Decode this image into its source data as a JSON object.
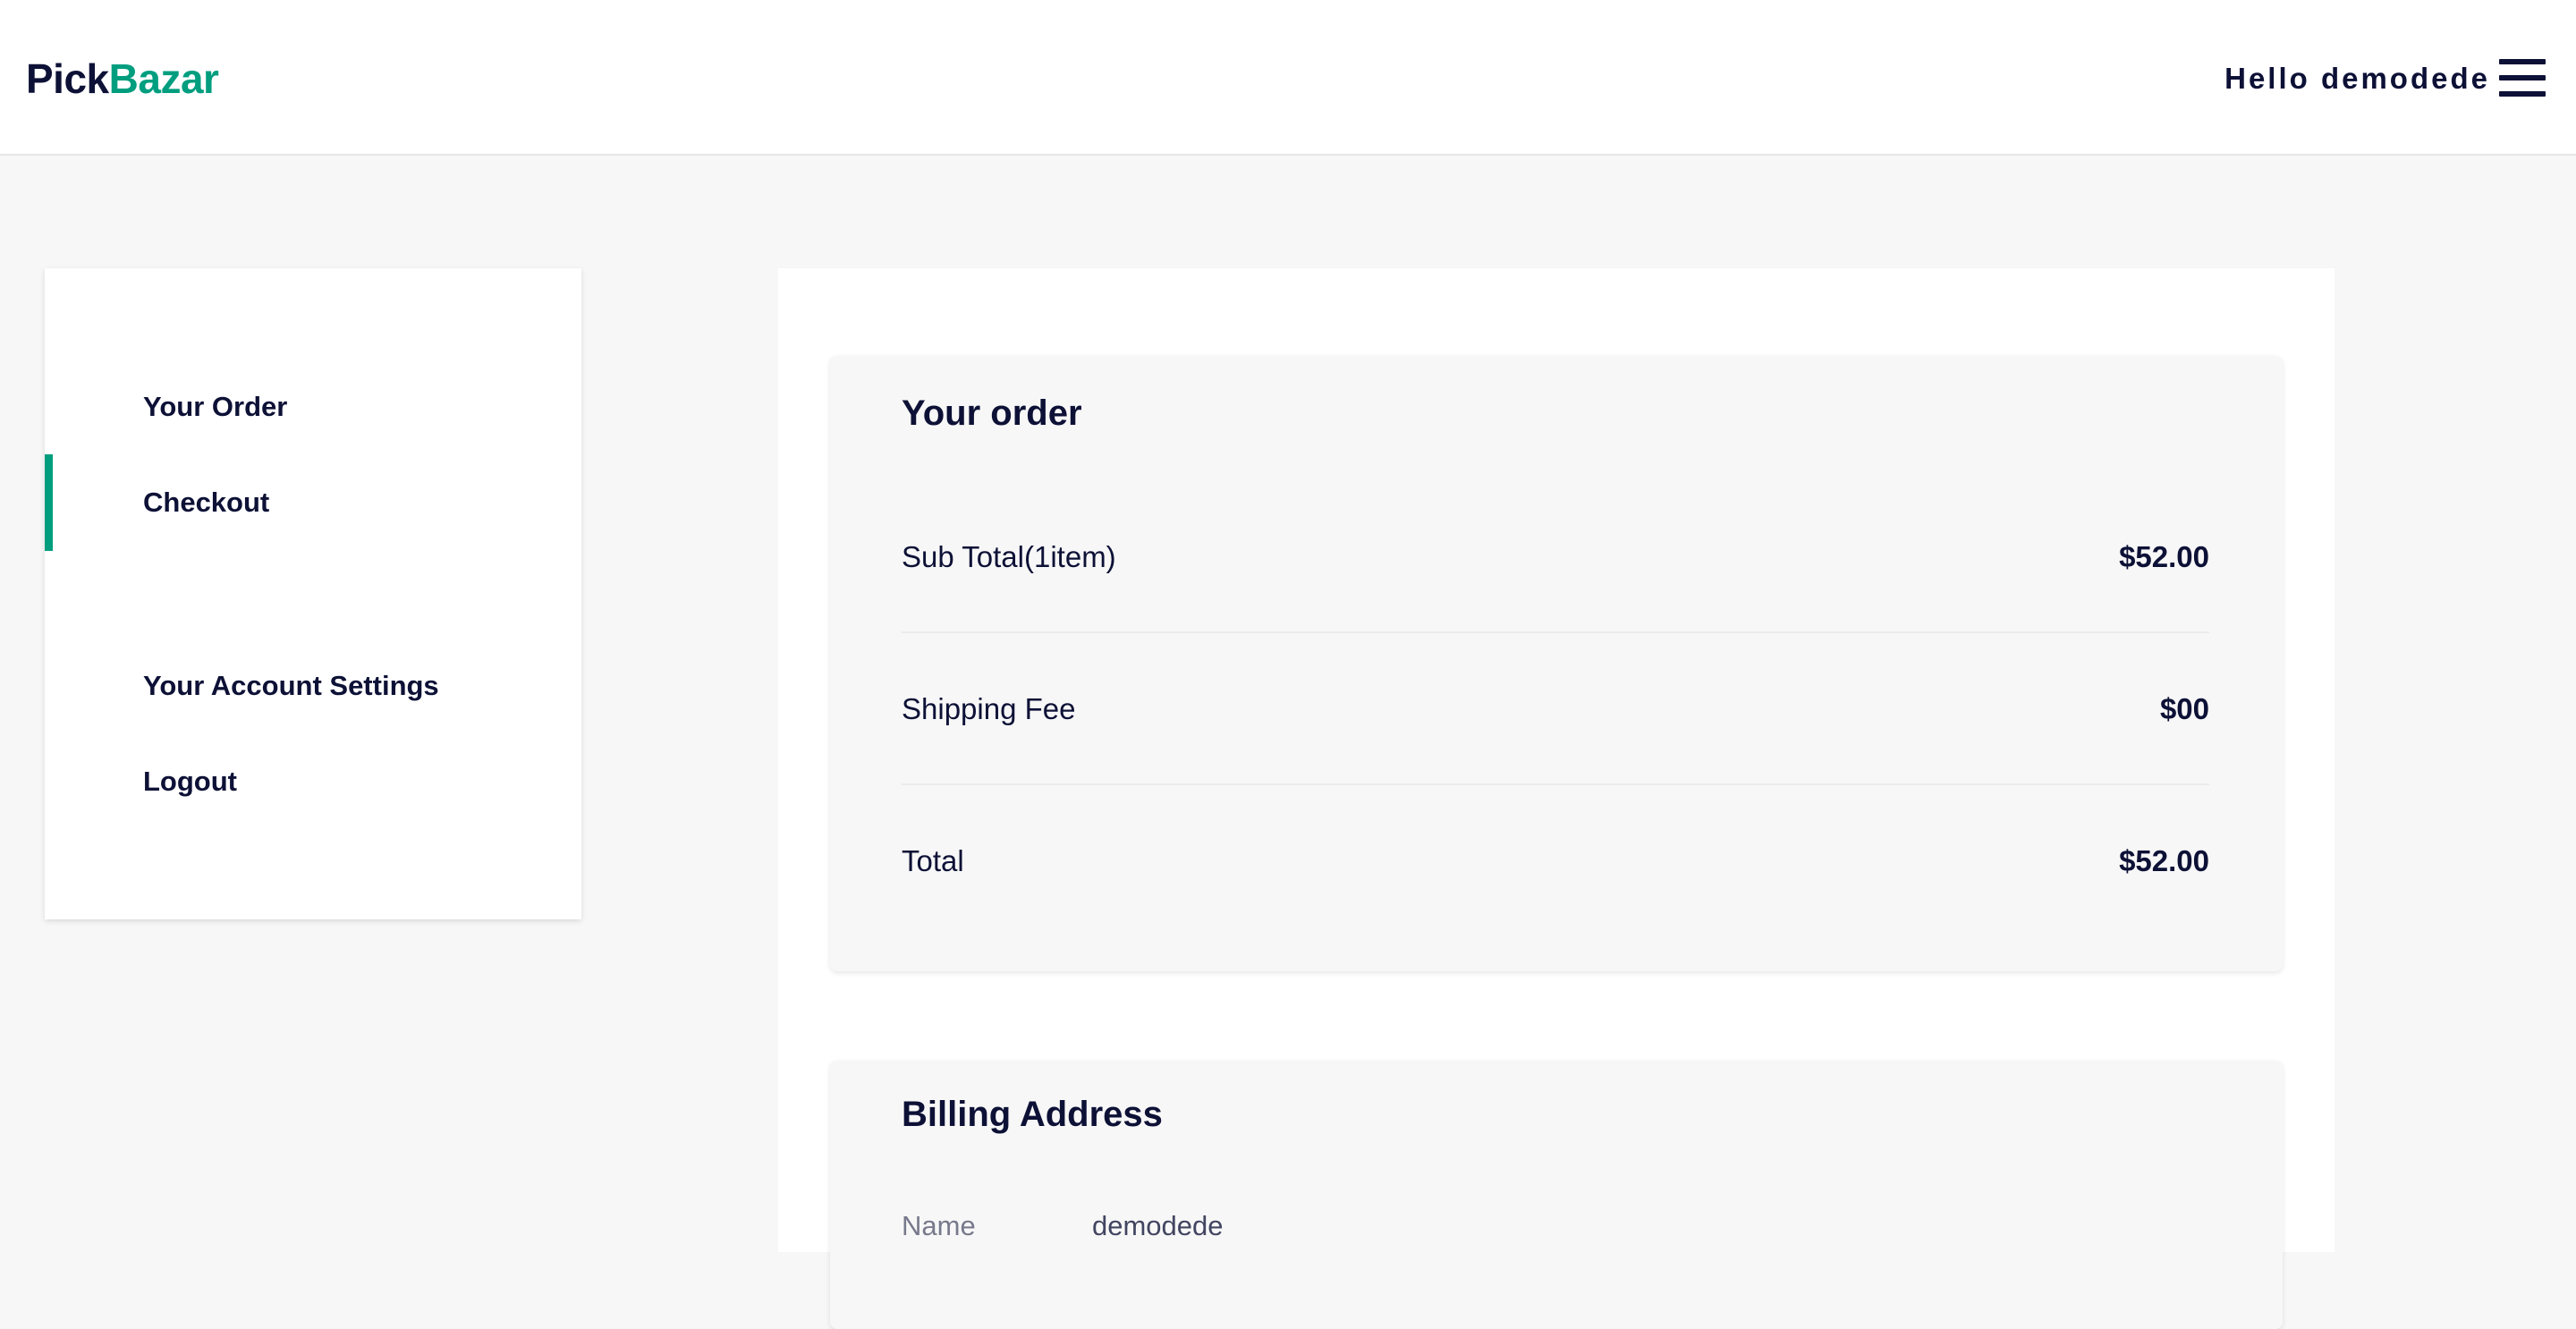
{
  "header": {
    "logo_part1": "Pick",
    "logo_part2": "Bazar",
    "greeting": "Hello demodede",
    "menu_icon": "hamburger-menu-icon"
  },
  "sidebar": {
    "items": [
      {
        "label": "Your Order",
        "active": false
      },
      {
        "label": "Checkout",
        "active": true
      },
      {
        "label": "Your Account Settings",
        "active": false
      },
      {
        "label": "Logout",
        "active": false
      }
    ]
  },
  "order": {
    "title": "Your order",
    "rows": [
      {
        "label": "Sub Total(1item)",
        "value": "$52.00"
      },
      {
        "label": "Shipping Fee",
        "value": "$00"
      },
      {
        "label": "Total",
        "value": "$52.00"
      }
    ]
  },
  "billing": {
    "title": "Billing Address",
    "name_label": "Name",
    "name_value": "demodede"
  },
  "colors": {
    "brand_dark": "#0d1136",
    "brand_green": "#009e7f",
    "background": "#f7f7f7"
  }
}
